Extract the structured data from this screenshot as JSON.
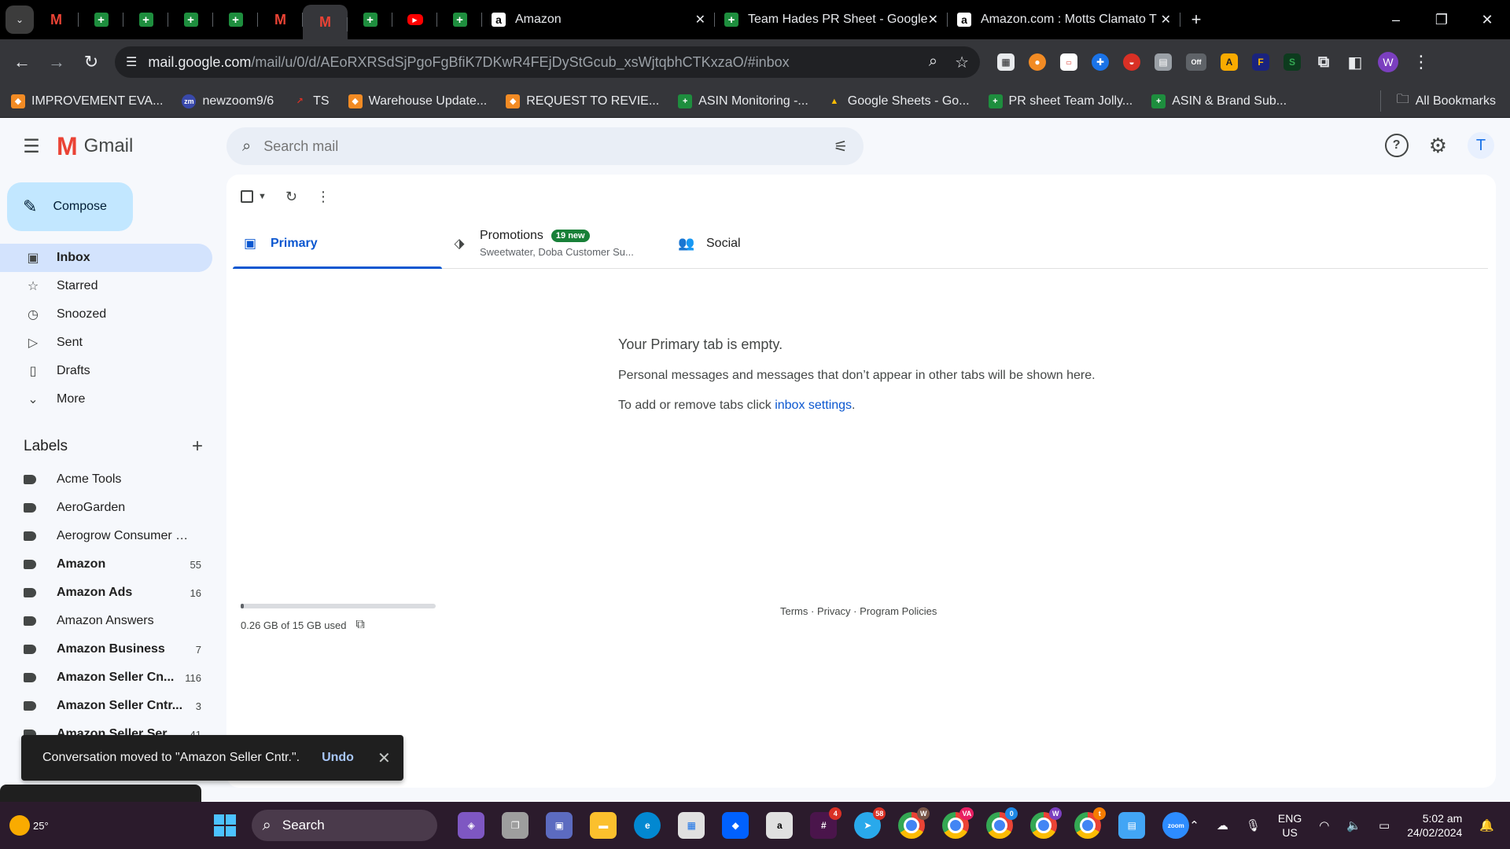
{
  "browser": {
    "tabs": [
      {
        "label": "Amazon"
      },
      {
        "label": "Team Hades PR Sheet - Google"
      },
      {
        "label": "Amazon.com : Motts Clamato T"
      }
    ],
    "url_host": "mail.google.com",
    "url_path": "/mail/u/0/d/AEoRXRSdSjPgoFgBfiK7DKwR4FEjDyStGcub_xsWjtqbhCTKxzaO/#inbox",
    "extension_off_label": "Off",
    "profile_initial": "W"
  },
  "bookmarks": {
    "items": [
      {
        "label": "IMPROVEMENT EVA..."
      },
      {
        "label": "newzoom9/6"
      },
      {
        "label": "TS"
      },
      {
        "label": "Warehouse Update..."
      },
      {
        "label": "REQUEST TO REVIE..."
      },
      {
        "label": "ASIN Monitoring -..."
      },
      {
        "label": "Google Sheets - Go..."
      },
      {
        "label": "PR sheet Team Jolly..."
      },
      {
        "label": "ASIN & Brand Sub..."
      }
    ],
    "all_label": "All Bookmarks"
  },
  "gmail": {
    "logo_text": "Gmail",
    "search_placeholder": "Search mail",
    "avatar_initial": "T",
    "compose_label": "Compose",
    "nav": [
      {
        "label": "Inbox"
      },
      {
        "label": "Starred"
      },
      {
        "label": "Snoozed"
      },
      {
        "label": "Sent"
      },
      {
        "label": "Drafts"
      },
      {
        "label": "More"
      }
    ],
    "labels_title": "Labels",
    "labels": [
      {
        "name": "Acme Tools",
        "count": ""
      },
      {
        "name": "AeroGarden",
        "count": ""
      },
      {
        "name": "Aerogrow Consumer Se...",
        "count": ""
      },
      {
        "name": "Amazon",
        "count": "55"
      },
      {
        "name": "Amazon Ads",
        "count": "16"
      },
      {
        "name": "Amazon Answers",
        "count": ""
      },
      {
        "name": "Amazon Business",
        "count": "7"
      },
      {
        "name": "Amazon Seller Cn...",
        "count": "116"
      },
      {
        "name": "Amazon Seller Cntr...",
        "count": "3"
      },
      {
        "name": "Amazon Seller Ser...",
        "count": "41"
      }
    ],
    "tabs": {
      "primary": "Primary",
      "promotions": "Promotions",
      "promotions_badge": "19 new",
      "promotions_sub": "Sweetwater, Doba Customer Su...",
      "social": "Social"
    },
    "empty": {
      "title": "Your Primary tab is empty.",
      "text": "Personal messages and messages that don’t appear in other tabs will be shown here.",
      "settings_prefix": "To add or remove tabs click ",
      "settings_link": "inbox settings",
      "settings_suffix": "."
    },
    "storage": {
      "text": "0.26 GB of 15 GB used",
      "fraction": 0.017
    },
    "footer": "Terms · Privacy · Program Policies",
    "snackbar": {
      "message": "Conversation moved to \"Amazon Seller Cntr.\".",
      "undo": "Undo"
    }
  },
  "taskbar": {
    "weather": "25°",
    "search_label": "Search",
    "badges": {
      "app1": "4",
      "app2": "58",
      "app3": "W",
      "app4": "VA",
      "app5": "0",
      "app6": "W",
      "app7": "t"
    },
    "lang_line1": "ENG",
    "lang_line2": "US",
    "time": "5:02 am",
    "date": "24/02/2024"
  },
  "colors": {
    "accent": "#0b57d0",
    "compose_bg": "#c2e7ff",
    "active_nav": "#d3e3fd",
    "badge_green": "#188038"
  }
}
